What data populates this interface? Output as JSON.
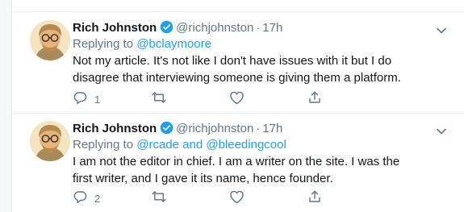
{
  "colors": {
    "accent": "#1da1f2",
    "text": "#14171a",
    "muted": "#657786",
    "divider": "#e6ecf0"
  },
  "tweets": [
    {
      "name": "Rich Johnston",
      "handle": "@richjohnston",
      "separator": "·",
      "time": "17h",
      "replying_prefix": "Replying to",
      "reply_targets": [
        "@bclaymoore"
      ],
      "reply_joiner": "",
      "text": "Not my article. It's not like I don't have issues with it but I do disagree that interviewing someone is giving them a platform.",
      "reply_count": "1",
      "icons": {
        "avatar": "avatar",
        "verified": "verified-badge-icon",
        "menu": "chevron-down-icon",
        "reply": "reply-icon",
        "retweet": "retweet-icon",
        "like": "heart-icon",
        "share": "share-icon"
      }
    },
    {
      "name": "Rich Johnston",
      "handle": "@richjohnston",
      "separator": "·",
      "time": "17h",
      "replying_prefix": "Replying to",
      "reply_targets": [
        "@rcade",
        "@bleedingcool"
      ],
      "reply_joiner": "and",
      "text": "I am not the editor in chief. I am a writer on the site. I was the first writer, and I gave it its name, hence founder.",
      "reply_count": "2",
      "icons": {
        "avatar": "avatar",
        "verified": "verified-badge-icon",
        "menu": "chevron-down-icon",
        "reply": "reply-icon",
        "retweet": "retweet-icon",
        "like": "heart-icon",
        "share": "share-icon"
      }
    }
  ]
}
